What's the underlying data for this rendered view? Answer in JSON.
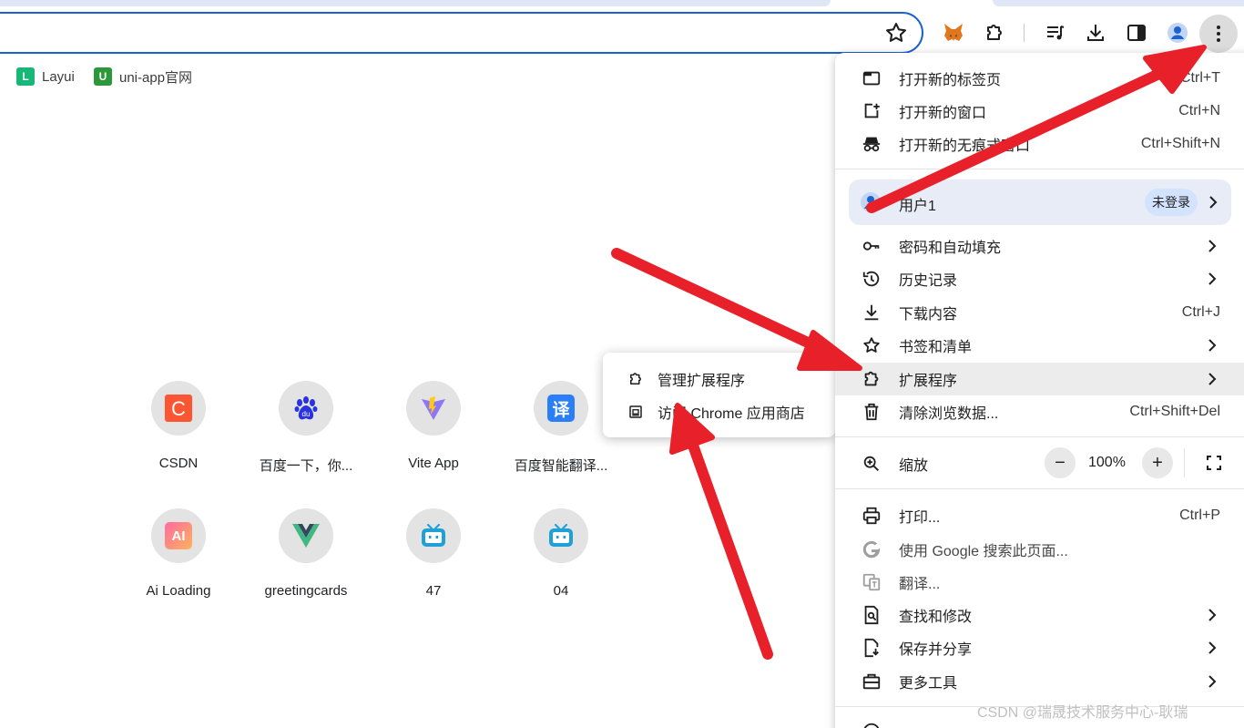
{
  "bookmarks": [
    {
      "label": "Layui",
      "color": "#16b777"
    },
    {
      "label": "uni-app官网",
      "color": "#2b9939"
    }
  ],
  "shortcuts": [
    {
      "label": "CSDN",
      "icon": "csdn-icon"
    },
    {
      "label": "百度一下，你...",
      "icon": "baidu-icon"
    },
    {
      "label": "Vite App",
      "icon": "vite-icon"
    },
    {
      "label": "百度智能翻译...",
      "icon": "translate-icon",
      "glyph": "译"
    },
    {
      "label": "Ai Loading",
      "icon": "ai-icon",
      "glyph": "AI"
    },
    {
      "label": "greetingcards",
      "icon": "vue-icon"
    },
    {
      "label": "47",
      "icon": "bilibili-icon"
    },
    {
      "label": "04",
      "icon": "bilibili-icon"
    }
  ],
  "menu": {
    "new_tab": {
      "label": "打开新的标签页",
      "shortcut": "Ctrl+T"
    },
    "new_window": {
      "label": "打开新的窗口",
      "shortcut": "Ctrl+N"
    },
    "incognito": {
      "label": "打开新的无痕式窗口",
      "shortcut": "Ctrl+Shift+N"
    },
    "profile": {
      "label": "用户1",
      "status": "未登录"
    },
    "passwords": {
      "label": "密码和自动填充"
    },
    "history": {
      "label": "历史记录"
    },
    "downloads": {
      "label": "下载内容",
      "shortcut": "Ctrl+J"
    },
    "bookmarks": {
      "label": "书签和清单"
    },
    "extensions": {
      "label": "扩展程序"
    },
    "clear_data": {
      "label": "清除浏览数据...",
      "shortcut": "Ctrl+Shift+Del"
    },
    "zoom": {
      "label": "缩放",
      "minus": "−",
      "value": "100%",
      "plus": "+"
    },
    "print": {
      "label": "打印...",
      "shortcut": "Ctrl+P"
    },
    "google_search": {
      "label": "使用 Google 搜索此页面..."
    },
    "translate": {
      "label": "翻译..."
    },
    "find_edit": {
      "label": "查找和修改"
    },
    "save_share": {
      "label": "保存并分享"
    },
    "more_tools": {
      "label": "更多工具"
    }
  },
  "submenu": {
    "manage": {
      "label": "管理扩展程序"
    },
    "store": {
      "label": "访问 Chrome 应用商店"
    }
  },
  "watermark": "CSDN @瑞晟技术服务中心-耿瑞",
  "colors": {
    "accent": "#1a62d0",
    "arrow": "#e8202a",
    "highlight": "#e8ecf7"
  }
}
